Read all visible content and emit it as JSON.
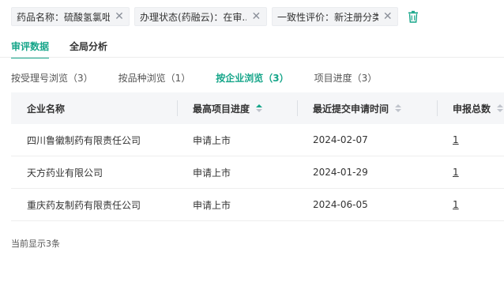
{
  "filters": [
    {
      "text": "药品名称：硫酸氢氯吡格...",
      "width": 150
    },
    {
      "text": "办理状态(药融云)：在审...",
      "width": 168
    },
    {
      "text": "一致性评价：新注册分类...",
      "width": 160
    }
  ],
  "main_tabs": [
    {
      "label": "审评数据",
      "active": true
    },
    {
      "label": "全局分析",
      "active": false
    }
  ],
  "sub_tabs": [
    {
      "label": "按受理号浏览（3）",
      "active": false
    },
    {
      "label": "按品种浏览（1）",
      "active": false
    },
    {
      "label": "按企业浏览（3）",
      "active": true
    },
    {
      "label": "项目进度（3）",
      "active": false
    }
  ],
  "table": {
    "columns": [
      {
        "label": "企业名称",
        "sortable": false
      },
      {
        "label": "最高项目进度",
        "sortable": true,
        "sort": "asc"
      },
      {
        "label": "最近提交申请时间",
        "sortable": true,
        "sort": "none"
      },
      {
        "label": "申报总数",
        "sortable": true,
        "sort": "none"
      }
    ],
    "rows": [
      [
        "四川鲁徽制药有限责任公司",
        "申请上市",
        "2024-02-07",
        "1"
      ],
      [
        "天方药业有限公司",
        "申请上市",
        "2024-01-29",
        "1"
      ],
      [
        "重庆药友制药有限责任公司",
        "申请上市",
        "2024-06-05",
        "1"
      ]
    ]
  },
  "footer": {
    "text": "当前显示3条"
  },
  "colors": {
    "accent": "#15a589",
    "header_bg": "#f5f6f8"
  },
  "icons": {
    "close": "close-icon",
    "trash": "trash-icon",
    "sort": "sort-icon"
  }
}
